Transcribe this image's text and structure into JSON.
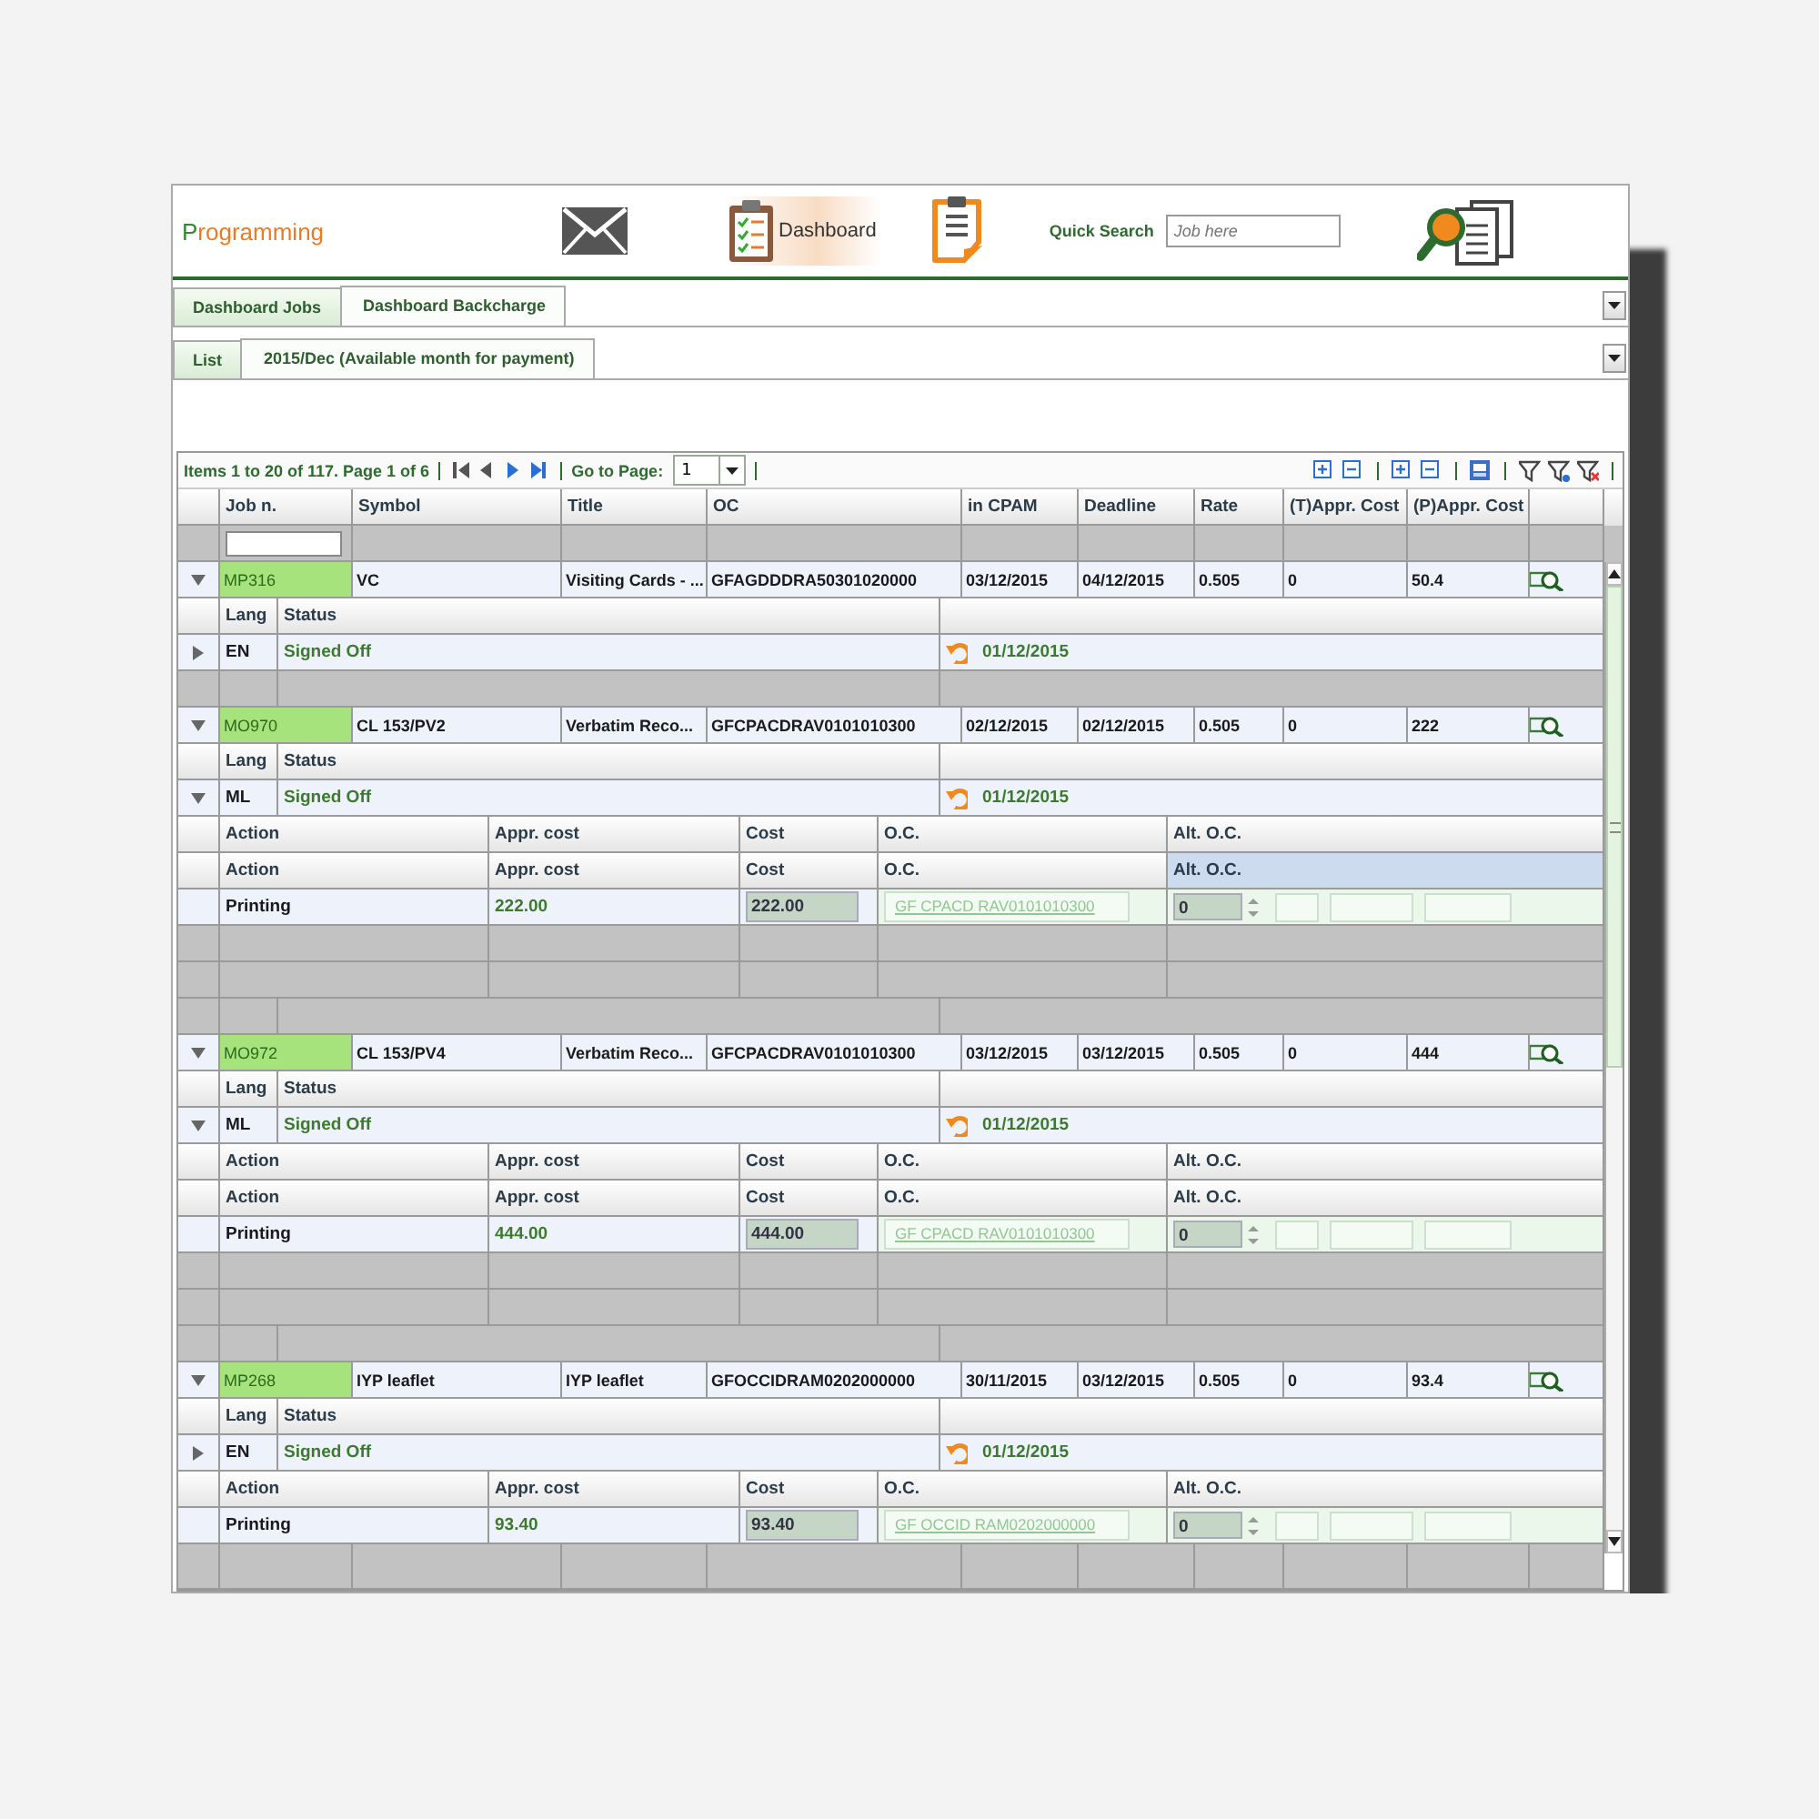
{
  "header": {
    "logo": "Programming",
    "dashboard_label": "Dashboard",
    "quick_search": {
      "label": "Quick Search",
      "placeholder": "Job here"
    }
  },
  "tabs": [
    {
      "label": "Dashboard Jobs",
      "selected": false
    },
    {
      "label": "Dashboard Backcharge",
      "selected": true
    }
  ],
  "subtabs": [
    {
      "label": "List",
      "selected": false
    },
    {
      "label": "2015/Dec (Available month for payment)",
      "selected": true
    }
  ],
  "grid": {
    "pager": "Items 1 to 20 of 117. Page 1 of 6",
    "goto_label": "Go to Page:",
    "page_value": "1",
    "columns": [
      "Job n.",
      "Symbol",
      "Title",
      "OC",
      "in CPAM",
      "Deadline",
      "Rate",
      "(T)Appr. Cost",
      "(P)Appr. Cost"
    ],
    "jobs": [
      {
        "job_no": "MP316",
        "symbol": "VC",
        "title": "Visiting Cards - ...",
        "oc": "GFAGDDDRA50301020000",
        "in_cpam": "03/12/2015",
        "deadline": "04/12/2015",
        "rate": "0.505",
        "t_appr_cost": "0",
        "p_appr_cost": "50.4",
        "expanded": true,
        "details": [
          {
            "kind": "lang-header",
            "labels": [
              "Lang",
              "Status"
            ]
          },
          {
            "kind": "language",
            "lang": "EN",
            "status": "Signed Off",
            "date": "01/12/2015",
            "expanded": false
          },
          {
            "kind": "blank-lang"
          }
        ]
      },
      {
        "job_no": "MO970",
        "symbol": "CL 153/PV2",
        "title": "Verbatim Reco...",
        "oc": "GFCPACDRAV0101010300",
        "in_cpam": "02/12/2015",
        "deadline": "02/12/2015",
        "rate": "0.505",
        "t_appr_cost": "0",
        "p_appr_cost": "222",
        "expanded": true,
        "details": [
          {
            "kind": "lang-header",
            "labels": [
              "Lang",
              "Status"
            ]
          },
          {
            "kind": "language",
            "lang": "ML",
            "status": "Signed Off",
            "date": "01/12/2015",
            "expanded": true
          },
          {
            "kind": "action-header",
            "cells": [
              {
                "label": "Action",
                "selected": false
              },
              {
                "label": "Appr. cost",
                "selected": false
              },
              {
                "label": "Cost",
                "selected": false
              },
              {
                "label": "O.C.",
                "selected": false
              },
              {
                "label": "Alt. O.C.",
                "selected": false
              }
            ]
          },
          {
            "kind": "action-header",
            "cells": [
              {
                "label": "Action",
                "selected": false
              },
              {
                "label": "Appr. cost",
                "selected": false
              },
              {
                "label": "Cost",
                "selected": false
              },
              {
                "label": "O.C.",
                "selected": false
              },
              {
                "label": "Alt. O.C.",
                "selected": true
              }
            ]
          },
          {
            "kind": "action",
            "action": "Printing",
            "appr_cost": "222.00",
            "cost": "222.00",
            "oc": "GF CPACD RAV0101010300",
            "alt_oc": "0"
          },
          {
            "kind": "blank-action"
          },
          {
            "kind": "blank-action"
          },
          {
            "kind": "blank-lang"
          }
        ]
      },
      {
        "job_no": "MO972",
        "symbol": "CL 153/PV4",
        "title": "Verbatim Reco...",
        "oc": "GFCPACDRAV0101010300",
        "in_cpam": "03/12/2015",
        "deadline": "03/12/2015",
        "rate": "0.505",
        "t_appr_cost": "0",
        "p_appr_cost": "444",
        "expanded": true,
        "details": [
          {
            "kind": "lang-header",
            "labels": [
              "Lang",
              "Status"
            ]
          },
          {
            "kind": "language",
            "lang": "ML",
            "status": "Signed Off",
            "date": "01/12/2015",
            "expanded": true
          },
          {
            "kind": "action-header",
            "cells": [
              {
                "label": "Action",
                "selected": false
              },
              {
                "label": "Appr. cost",
                "selected": false
              },
              {
                "label": "Cost",
                "selected": false
              },
              {
                "label": "O.C.",
                "selected": false
              },
              {
                "label": "Alt. O.C.",
                "selected": false
              }
            ]
          },
          {
            "kind": "action-header",
            "cells": [
              {
                "label": "Action",
                "selected": false
              },
              {
                "label": "Appr. cost",
                "selected": false
              },
              {
                "label": "Cost",
                "selected": false
              },
              {
                "label": "O.C.",
                "selected": false
              },
              {
                "label": "Alt. O.C.",
                "selected": false
              }
            ]
          },
          {
            "kind": "action",
            "action": "Printing",
            "appr_cost": "444.00",
            "cost": "444.00",
            "oc": "GF CPACD RAV0101010300",
            "alt_oc": "0"
          },
          {
            "kind": "blank-action"
          },
          {
            "kind": "blank-action"
          },
          {
            "kind": "blank-lang"
          }
        ]
      },
      {
        "job_no": "MP268",
        "symbol": "IYP leaflet",
        "title": "IYP leaflet",
        "oc": "GFOCCIDRAM0202000000",
        "in_cpam": "30/11/2015",
        "deadline": "03/12/2015",
        "rate": "0.505",
        "t_appr_cost": "0",
        "p_appr_cost": "93.4",
        "expanded": true,
        "details": [
          {
            "kind": "lang-header",
            "labels": [
              "Lang",
              "Status"
            ]
          },
          {
            "kind": "language",
            "lang": "EN",
            "status": "Signed Off",
            "date": "01/12/2015",
            "expanded": false
          },
          {
            "kind": "action-header",
            "cells": [
              {
                "label": "Action",
                "selected": false
              },
              {
                "label": "Appr. cost",
                "selected": false
              },
              {
                "label": "Cost",
                "selected": false
              },
              {
                "label": "O.C.",
                "selected": false
              },
              {
                "label": "Alt. O.C.",
                "selected": false
              }
            ]
          },
          {
            "kind": "action",
            "action": "Printing",
            "appr_cost": "93.40",
            "cost": "93.40",
            "oc": "GF OCCID RAM0202000000",
            "alt_oc": "0"
          }
        ]
      }
    ]
  }
}
